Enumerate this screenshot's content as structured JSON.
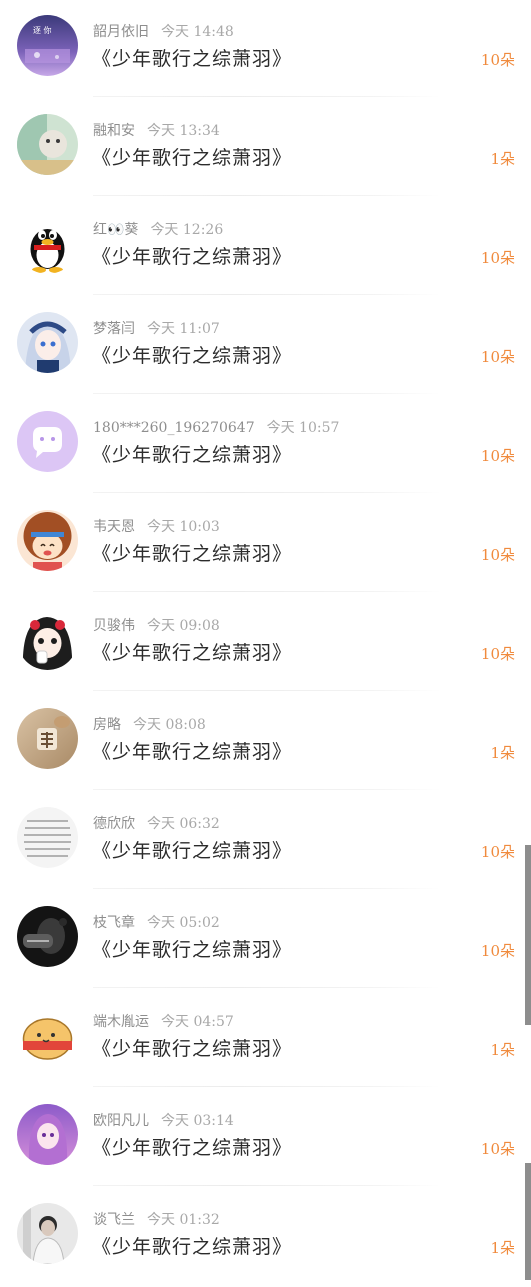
{
  "colors": {
    "accent_count": "#f08a3c",
    "username": "#8e8e8e",
    "time": "#a8a8a8",
    "title": "#2b2b2b"
  },
  "items": [
    {
      "username": "韶月依旧",
      "time": "今天 14:48",
      "title": "《少年歌行之综萧羽》",
      "count": "10朵",
      "avatar": "purple-wallpaper-avatar"
    },
    {
      "username": "融和安",
      "time": "今天 13:34",
      "title": "《少年歌行之综萧羽》",
      "count": "1朵",
      "avatar": "cat-photo-avatar"
    },
    {
      "username": "红👀葵",
      "time": "今天 12:26",
      "title": "《少年歌行之综萧羽》",
      "count": "10朵",
      "avatar": "penguin-avatar"
    },
    {
      "username": "梦落闫",
      "time": "今天 11:07",
      "title": "《少年歌行之综萧羽》",
      "count": "10朵",
      "avatar": "anime-girl-avatar"
    },
    {
      "username": "180***260_196270647",
      "time": "今天 10:57",
      "title": "《少年歌行之综萧羽》",
      "count": "10朵",
      "avatar": "default-chat-avatar"
    },
    {
      "username": "韦天恩",
      "time": "今天 10:03",
      "title": "《少年歌行之综萧羽》",
      "count": "10朵",
      "avatar": "cartoon-girl-avatar"
    },
    {
      "username": "贝骏伟",
      "time": "今天 09:08",
      "title": "《少年歌行之综萧羽》",
      "count": "10朵",
      "avatar": "cartoon-kid-avatar"
    },
    {
      "username": "房略",
      "time": "今天 08:08",
      "title": "《少年歌行之综萧羽》",
      "count": "1朵",
      "avatar": "photo-avatar"
    },
    {
      "username": "德欣欣",
      "time": "今天 06:32",
      "title": "《少年歌行之综萧羽》",
      "count": "10朵",
      "avatar": "text-image-avatar"
    },
    {
      "username": "枝飞章",
      "time": "今天 05:02",
      "title": "《少年歌行之综萧羽》",
      "count": "10朵",
      "avatar": "dark-photo-avatar"
    },
    {
      "username": "端木胤运",
      "time": "今天 04:57",
      "title": "《少年歌行之综萧羽》",
      "count": "1朵",
      "avatar": "cartoon-bun-avatar"
    },
    {
      "username": "欧阳凡儿",
      "time": "今天 03:14",
      "title": "《少年歌行之综萧羽》",
      "count": "10朵",
      "avatar": "anime-purple-avatar"
    },
    {
      "username": "谈飞兰",
      "time": "今天 01:32",
      "title": "《少年歌行之综萧羽》",
      "count": "1朵",
      "avatar": "portrait-photo-avatar"
    }
  ]
}
